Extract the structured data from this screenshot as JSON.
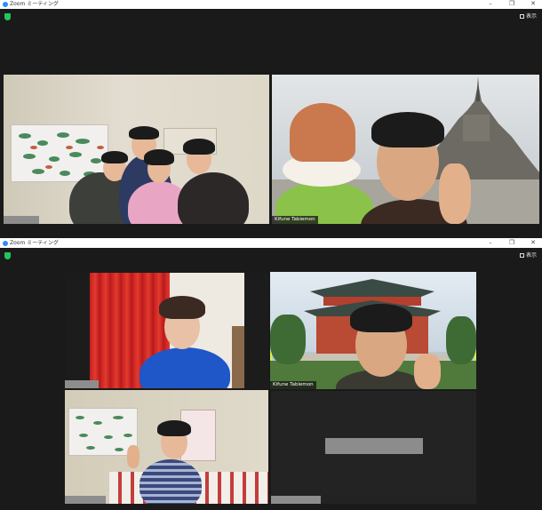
{
  "window1": {
    "title": "Zoom ミーティング",
    "controls": [
      "–",
      "❐",
      "✕"
    ],
    "view_button": "表示",
    "tiles": [
      {
        "name": ""
      },
      {
        "name": "Kifune Tabiemon"
      }
    ]
  },
  "window2": {
    "title": "Zoom ミーティング",
    "controls": [
      "–",
      "❐",
      "✕"
    ],
    "view_button": "表示",
    "tiles": [
      {
        "name": ""
      },
      {
        "name": "Kifune Tabiemon"
      },
      {
        "name": ""
      },
      {
        "name": ""
      }
    ]
  },
  "colors": {
    "zoom_blue": "#2d8cff",
    "security_green": "#22c55e",
    "active_speaker": "#d6f14e",
    "meeting_bg": "#1a1a1a"
  }
}
